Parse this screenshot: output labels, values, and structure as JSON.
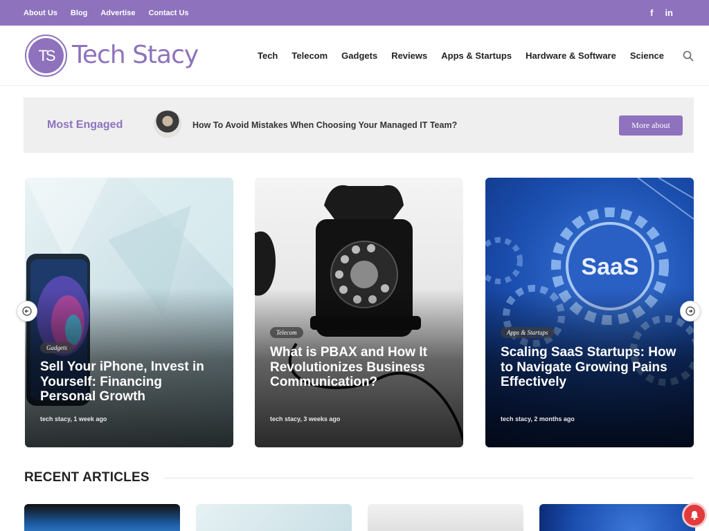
{
  "topbar": {
    "links": [
      "About Us",
      "Blog",
      "Advertise",
      "Contact Us"
    ],
    "social": {
      "facebook": "f",
      "linkedin": "in"
    }
  },
  "header": {
    "logo_mark": "TS",
    "logo_text": "Tech Stacy",
    "nav": [
      "Tech",
      "Telecom",
      "Gadgets",
      "Reviews",
      "Apps & Startups",
      "Hardware & Software",
      "Science"
    ]
  },
  "engaged": {
    "label": "Most Engaged",
    "headline": "How To Avoid Mistakes When Choosing Your Managed IT Team?",
    "button": "More about"
  },
  "slider": {
    "cards": [
      {
        "category": "Gadgets",
        "title": "Sell Your iPhone, Invest in Yourself: Financing Personal Growth",
        "meta": "tech stacy, 1 week ago"
      },
      {
        "category": "Telecom",
        "title": "What is PBAX and How It Revolutionizes Business Communication?",
        "meta": "tech stacy, 3 weeks ago"
      },
      {
        "category": "Apps & Startups",
        "title": "Scaling SaaS Startups: How to Navigate Growing Pains Effectively",
        "meta": "tech stacy, 2 months ago",
        "image_text": "SaaS"
      }
    ]
  },
  "recent": {
    "title": "RECENT ARTICLES"
  },
  "colors": {
    "accent": "#8e72bd",
    "notification": "#e33b3b"
  }
}
